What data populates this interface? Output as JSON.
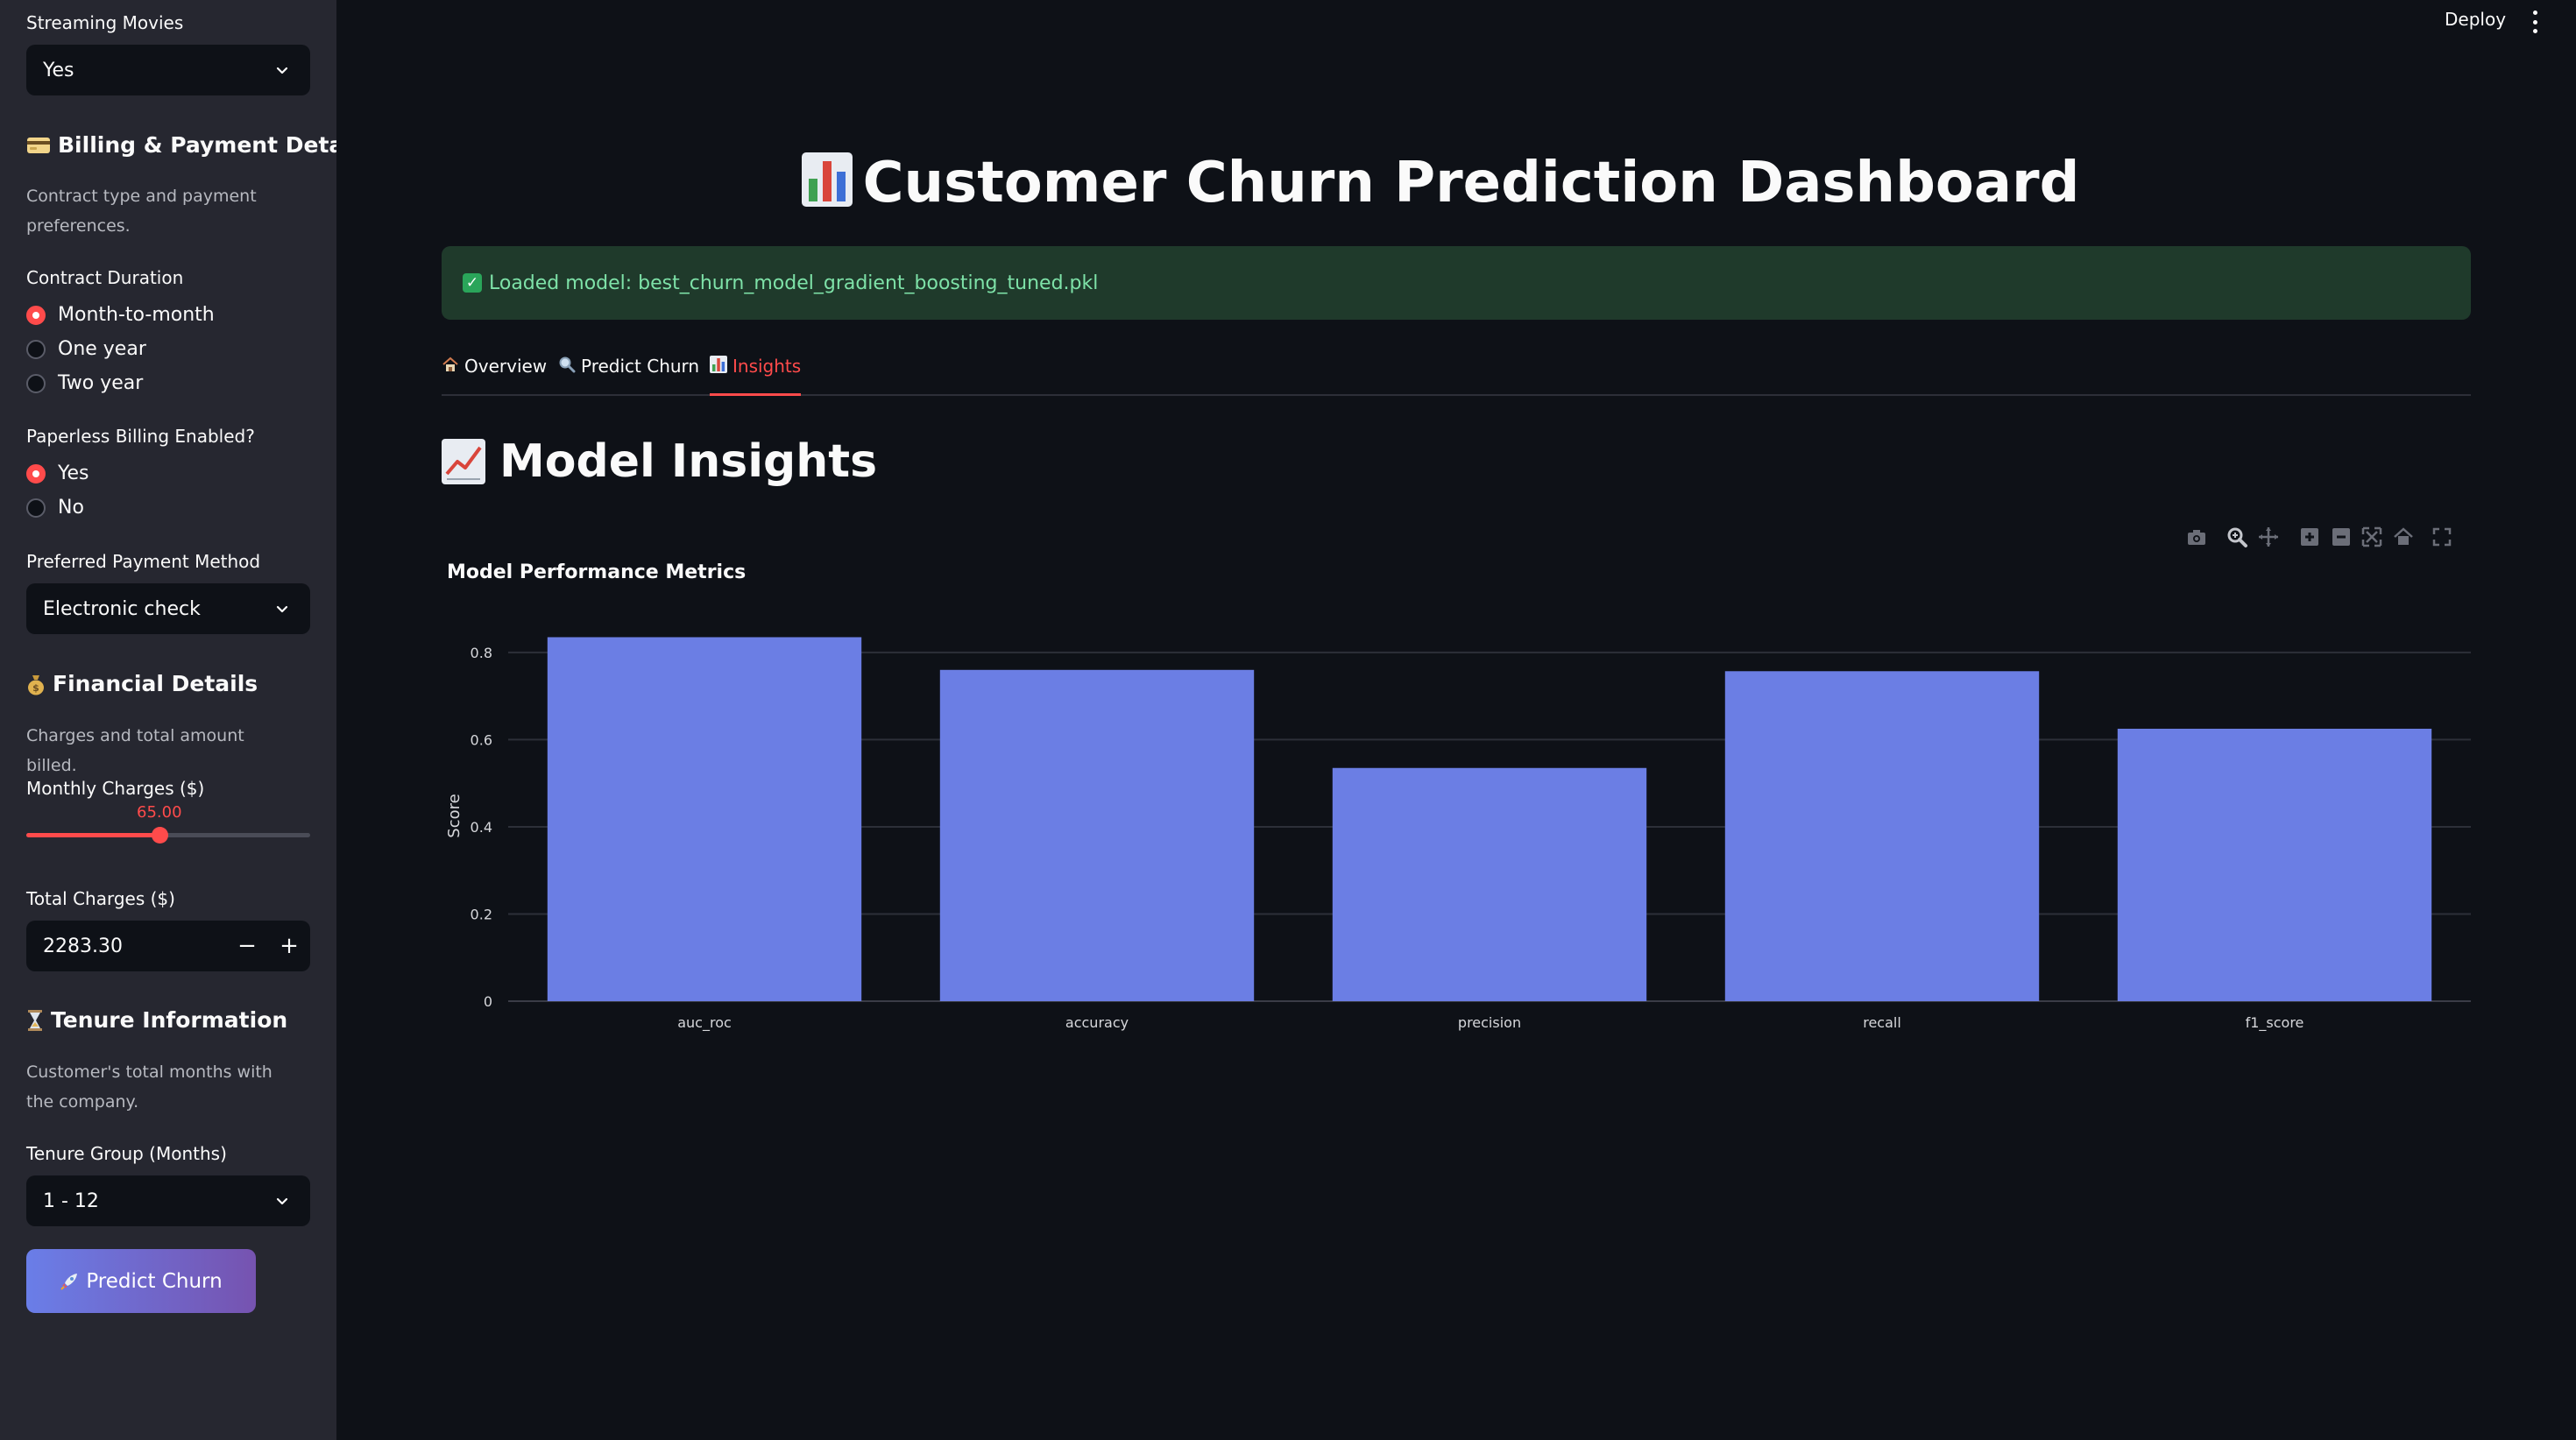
{
  "topbar": {
    "deploy_label": "Deploy"
  },
  "sidebar": {
    "streaming_movies": {
      "label": "Streaming Movies",
      "value": "Yes"
    },
    "billing": {
      "icon": "credit-card-icon",
      "heading": "Billing & Payment Details",
      "caption": "Contract type and payment preferences.",
      "contract": {
        "label": "Contract Duration",
        "options": [
          "Month-to-month",
          "One year",
          "Two year"
        ],
        "selected": "Month-to-month"
      },
      "paperless": {
        "label": "Paperless Billing Enabled?",
        "options": [
          "Yes",
          "No"
        ],
        "selected": "Yes"
      },
      "payment": {
        "label": "Preferred Payment Method",
        "value": "Electronic check"
      }
    },
    "financial": {
      "icon": "money-bag-icon",
      "heading": "Financial Details",
      "caption": "Charges and total amount billed.",
      "monthly": {
        "label": "Monthly Charges ($)",
        "value": "65.00",
        "fraction": 0.47
      },
      "total": {
        "label": "Total Charges ($)",
        "value": "2283.30"
      }
    },
    "tenure": {
      "icon": "hourglass-icon",
      "heading": "Tenure Information",
      "caption": "Customer's total months with the company.",
      "group": {
        "label": "Tenure Group (Months)",
        "value": "1 - 12"
      }
    },
    "predict_button": "Predict Churn"
  },
  "main": {
    "title": "Customer Churn Prediction Dashboard",
    "alert": "Loaded model: best_churn_model_gradient_boosting_tuned.pkl",
    "tabs": [
      {
        "label": "Overview",
        "icon": "house-icon"
      },
      {
        "label": "Predict Churn",
        "icon": "magnifier-icon"
      },
      {
        "label": "Insights",
        "icon": "bar-chart-icon",
        "active": true
      }
    ],
    "section_title": "Model Insights"
  },
  "colors": {
    "accent": "#ff4b4b",
    "bar": "#6b7ee4",
    "background": "#0e1117",
    "sidebar": "#262730"
  },
  "chart_data": {
    "type": "bar",
    "title": "Model Performance Metrics",
    "xlabel": "",
    "ylabel": "Score",
    "categories": [
      "auc_roc",
      "accuracy",
      "precision",
      "recall",
      "f1_score"
    ],
    "values": [
      0.835,
      0.76,
      0.535,
      0.757,
      0.625
    ],
    "ylim": [
      0,
      0.85
    ],
    "yticks": [
      0,
      0.2,
      0.4,
      0.6,
      0.8
    ],
    "ytick_labels": [
      "0",
      "0.2",
      "0.4",
      "0.6",
      "0.8"
    ],
    "grid": true,
    "legend": "none"
  }
}
